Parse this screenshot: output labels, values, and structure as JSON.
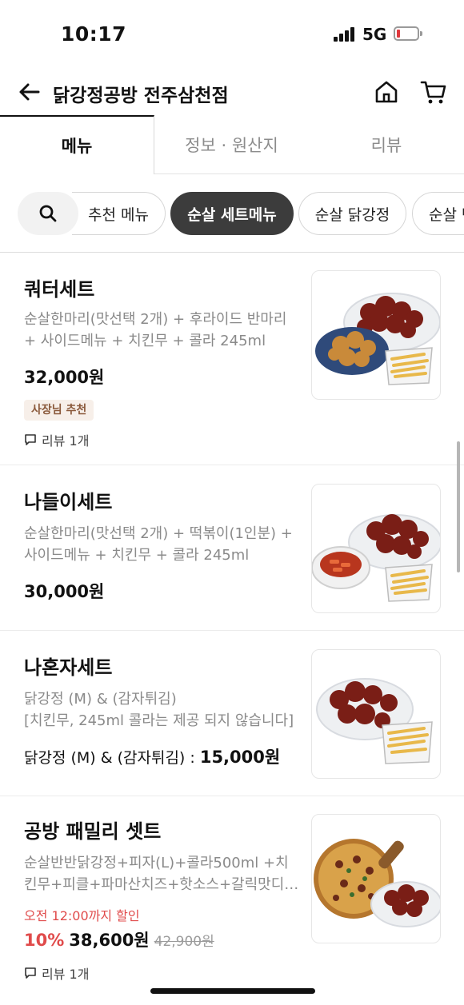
{
  "status_bar": {
    "time": "10:17",
    "network": "5G",
    "battery_level": 0.1
  },
  "header": {
    "title": "닭강정공방 전주삼천점",
    "back_icon": "arrow-left-icon",
    "home_icon": "home-icon",
    "cart_icon": "cart-icon"
  },
  "tabs": [
    {
      "label": "메뉴",
      "active": true
    },
    {
      "label": "정보 · 원산지",
      "active": false
    },
    {
      "label": "리뷰",
      "active": false
    }
  ],
  "categories": {
    "search_icon": "search-icon",
    "chips": [
      {
        "label": "추천 메뉴",
        "active": false
      },
      {
        "label": "순살 세트메뉴",
        "active": true
      },
      {
        "label": "순살 닭강정",
        "active": false
      },
      {
        "label": "순살 반",
        "active": false
      }
    ]
  },
  "menu": [
    {
      "name": "쿼터세트",
      "desc": [
        "순살한마리(맛선택 2개) + 후라이드 반마리",
        "+ 사이드메뉴 + 치킨무 + 콜라 245ml"
      ],
      "price": "32,000원",
      "badge": "사장님 추천",
      "review": "리뷰 1개",
      "image": "chicken-fries-set-photo"
    },
    {
      "name": "나들이세트",
      "desc": [
        "순살한마리(맛선택 2개) + 떡볶이(1인분) +",
        "사이드메뉴 + 치킨무 + 콜라 245ml"
      ],
      "price": "30,000원",
      "image": "chicken-tteokbokki-set-photo"
    },
    {
      "name": "나혼자세트",
      "desc": [
        "닭강정 (M) & (감자튀김)",
        "[치킨무, 245ml 콜라는 제공 되지 않습니다]"
      ],
      "price_prefix": "닭강정 (M) & (감자튀김) : ",
      "price": "15,000원",
      "image": "chicken-fries-single-photo"
    },
    {
      "name": "공방 패밀리 셋트",
      "desc": [
        "순살반반닭강정+피자(L)+콜라500ml +치",
        "킨무+피클+파마산치즈+핫소스+갈릭맛디핑소스"
      ],
      "sale_note": "오전 12:00까지 할인",
      "discount": "10%",
      "price": "38,600원",
      "original_price": "42,900원",
      "review": "리뷰 1개",
      "image": "pizza-chicken-set-photo"
    }
  ]
}
